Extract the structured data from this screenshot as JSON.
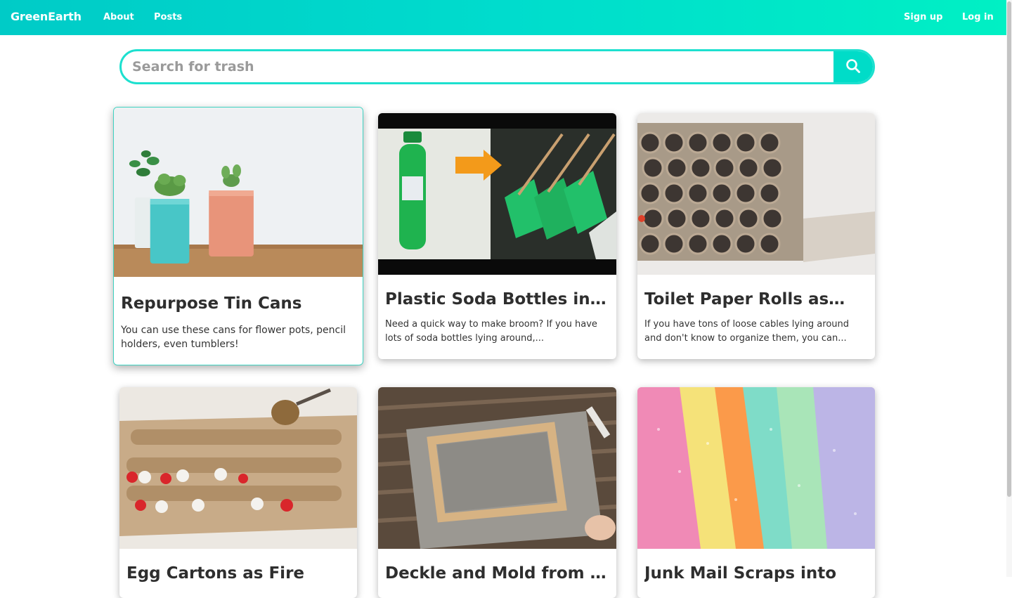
{
  "navbar": {
    "brand": "GreenEarth",
    "links": [
      "About",
      "Posts"
    ],
    "auth": [
      "Sign up",
      "Log in"
    ],
    "gradient": [
      "#00cbc7",
      "#00f0c4"
    ]
  },
  "search": {
    "placeholder": "Search for trash",
    "value": "",
    "icon": "search-icon",
    "accent": "#00dcc8"
  },
  "posts": [
    {
      "title": "Repurpose Tin Cans",
      "description": "You can use these cans for flower pots, pencil holders, even tumblers!",
      "image": "tin-cans-planters-image"
    },
    {
      "title": "Plastic Soda Bottles into …",
      "description": "Need a quick way to make broom? If you have lots of soda bottles lying around,...",
      "image": "soda-bottle-broom-image"
    },
    {
      "title": "Toilet Paper Rolls as…",
      "description": "If you have tons of loose cables lying around and don't know to organize them, you can...",
      "image": "toilet-paper-rolls-organizer-image"
    },
    {
      "title": "Egg Cartons as Fire",
      "description": "",
      "image": "egg-carton-fire-starter-image"
    },
    {
      "title": "Deckle and Mold from Bu",
      "description": "",
      "image": "deckle-and-mold-image"
    },
    {
      "title": "Junk Mail Scraps into",
      "description": "",
      "image": "recycled-paper-sheets-image"
    }
  ]
}
